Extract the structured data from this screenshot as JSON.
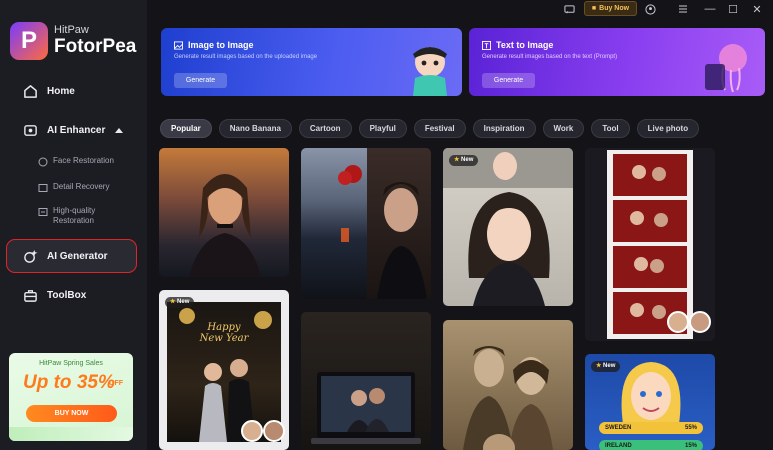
{
  "app": {
    "brand_sub": "HitPaw",
    "brand_main": "FotorPea",
    "logo_letter": "P"
  },
  "titlebar": {
    "buy_now": "Buy Now",
    "minimize": "—",
    "maximize": "☐",
    "close": "✕"
  },
  "sidebar": {
    "home": "Home",
    "ai_enhancer": "AI Enhancer",
    "face_restoration": "Face Restoration",
    "detail_recovery": "Detail Recovery",
    "hq_restoration_1": "High-quality",
    "hq_restoration_2": "Restoration",
    "ai_generator": "AI Generator",
    "toolbox": "ToolBox"
  },
  "promo": {
    "title": "HitPaw Spring Sales",
    "big_text": "Up to 35%",
    "off": "OFF",
    "button": "BUY NOW"
  },
  "banners": {
    "image_to_image": {
      "title": "Image to Image",
      "desc": "Generate result images based on the uploaded image",
      "button": "Generate"
    },
    "text_to_image": {
      "title": "Text to Image",
      "desc": "Generate result images based on the text (Prompt)",
      "button": "Generate"
    }
  },
  "tabs": [
    "Popular",
    "Nano Banana",
    "Cartoon",
    "Playful",
    "Festival",
    "Inspiration",
    "Work",
    "Tool",
    "Live photo"
  ],
  "active_tab": "Popular",
  "gallery": {
    "new_badge": "New",
    "happy_new_year_1": "Happy",
    "happy_new_year_2": "New Year",
    "vote_rows": [
      {
        "country": "SWEDEN",
        "pct": "55%"
      },
      {
        "country": "IRELAND",
        "pct": "15%"
      }
    ]
  },
  "colors": {
    "accent_red": "#e0242a",
    "bg": "#131318",
    "sidebar": "#1c1c23",
    "buy_now": "#f4c15a"
  }
}
